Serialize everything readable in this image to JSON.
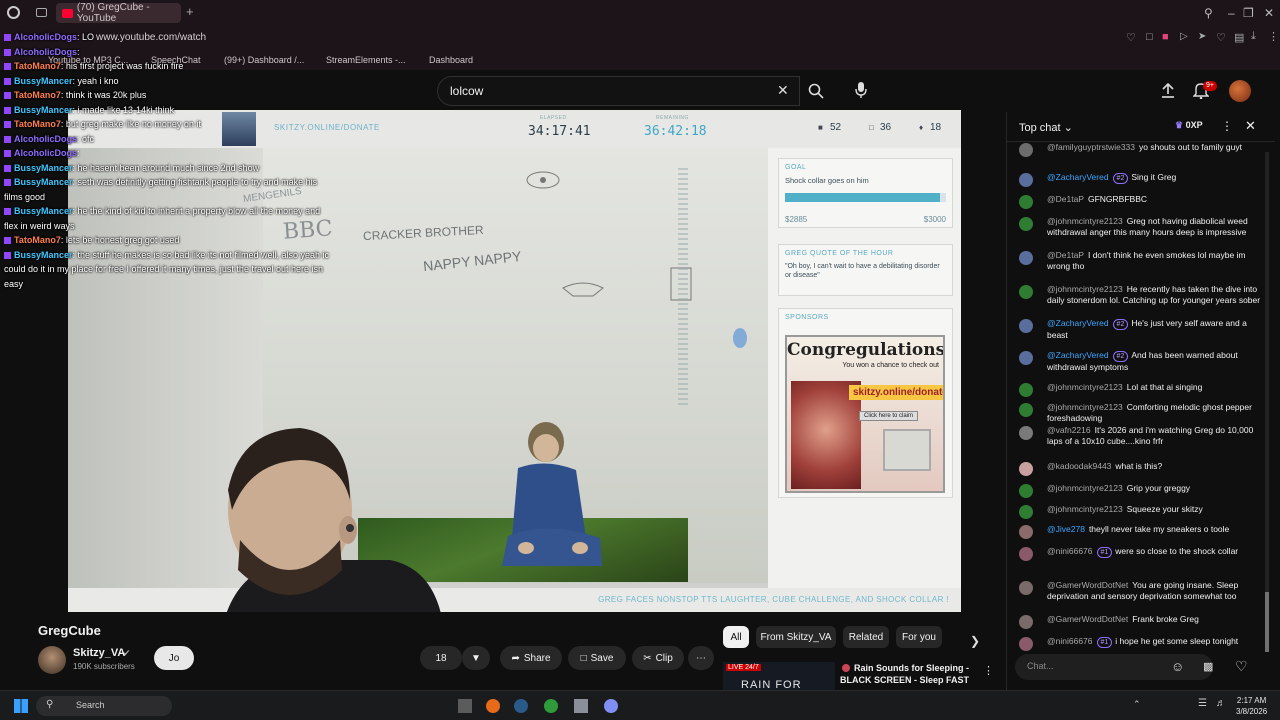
{
  "browser": {
    "tab_title": "(70) GregCube - YouTube",
    "url": "www.youtube.com/watch",
    "bookmarks": [
      "Youtube to MP3 C...",
      "SpeechChat",
      "(99+) Dashboard /...",
      "StreamElements -...",
      "Dashboard"
    ]
  },
  "youtube_header": {
    "search_value": "lolcow",
    "notification_count": "9+"
  },
  "stream_overlay": {
    "donate_url": "SKITZY.ONLINE/DONATE",
    "elapsed_label": "ELAPSED",
    "elapsed": "34:17:41",
    "remaining_label": "REMAINING",
    "remaining": "36:42:18",
    "stat1": "52",
    "stat2": "36",
    "stat3": "18",
    "goal_header": "GOAL",
    "goal_text": "Shock collar goes on him",
    "goal_current": "$2885",
    "goal_target": "$3000",
    "goal_progress": 0.96,
    "quote_header": "GREG QUOTE OF THE HOUR",
    "quote_text": "\"Oh boy, I can't wait to have a debilitating disorder or disease\"",
    "sponsors_header": "SPONSORS",
    "ad_title": "Congregulations",
    "ad_line": "You won a chance to check out",
    "ad_url": "skitzy.online/donate",
    "ad_button": "Click here to claim",
    "bottom_banner": "GREG FACES NONSTOP TTS LAUGHTER, CUBE CHALLENGE, AND SHOCK COLLAR !",
    "wall_writing": [
      "BBC",
      "CRACKER BROTHER",
      "NAPPY NAPPY",
      "MENGENILS"
    ]
  },
  "twitch_chat": [
    {
      "user": "AlcoholicDogs",
      "color": "#8e6bff",
      "text": ": LO"
    },
    {
      "user": "AlcoholicDogs",
      "color": "#8e6bff",
      "text": ":"
    },
    {
      "user": "TatoMano7",
      "color": "#ff7f50",
      "text": ": his first project was fuckin fire"
    },
    {
      "user": "BussyMancer",
      "color": "#3ec8ff",
      "text": ": yeah i kno"
    },
    {
      "user": "TatoMano7",
      "color": "#ff7f50",
      "text": ": think it was 20k plus"
    },
    {
      "user": "BussyMancer",
      "color": "#3ec8ff",
      "text": ": i made like 13-14ki think"
    },
    {
      "user": "TatoMano7",
      "color": "#ff7f50",
      "text": ": but greg make like no money on it"
    },
    {
      "user": "AlcoholicDogs",
      "color": "#8e6bff",
      "text": ": ofc"
    },
    {
      "user": "AlcoholicDogs",
      "color": "#8e6bff",
      "text": ":"
    },
    {
      "user": "BussyMancer",
      "color": "#3ec8ff",
      "text": ": he hasent been around much since 2nd show"
    },
    {
      "user": "BussyMancer",
      "color": "#3ec8ff",
      "text": ": seth was definitly getting fishtank people to try and make his"
    },
    {
      "user": "",
      "color": "#ffffff",
      "text": "films good"
    },
    {
      "user": "BussyMancer",
      "color": "#3ec8ff",
      "text": ": he the kind of kid to inherit a property blow all the money and"
    },
    {
      "user": "",
      "color": "#ffffff",
      "text": "flex in weird ways"
    },
    {
      "user": "TatoMano7",
      "color": "#ff7f50",
      "text": ": lets be honest greg got used"
    },
    {
      "user": "BussyMancer",
      "color": "#3ec8ff",
      "text": ": the stuff he makes is so bad like its not filmed well, also yeah ic"
    },
    {
      "user": "",
      "color": "#ffffff",
      "text": "could do it in my place for free I offered it many times, just the travel out here isn"
    },
    {
      "user": "",
      "color": "#ffffff",
      "text": "easy"
    }
  ],
  "below_video": {
    "channel_title": "GregCube",
    "channel_name": "Skitzy_VA",
    "subscribers": "190K subscribers",
    "join_label": "Jo",
    "like_count": "18",
    "share_label": "Share",
    "save_label": "Save",
    "clip_label": "Clip",
    "filters": [
      "All",
      "From Skitzy_VA",
      "Related",
      "For you"
    ],
    "rec_title": "Rain Sounds for Sleeping - BLACK SCREEN - Sleep FAST ...",
    "rec_badge": "LIVE 24/7",
    "rec_thumb_text": "RAIN FOR"
  },
  "live_chat": {
    "header": "Top chat",
    "xp": "0XP",
    "input_placeholder": "Chat...",
    "messages": [
      {
        "author": "@familyguyptrstwie333",
        "badge": "",
        "text": "yo shouts out to family guyt",
        "mod": false
      },
      {
        "author": "@ZacharyVered",
        "badge": "#2",
        "text": "Sing it Greg",
        "mod": true
      },
      {
        "author": "@De1taP",
        "badge": "",
        "text": "GFNGRBFBBC",
        "mod": false
      },
      {
        "author": "@johnmcintyre2123",
        "badge": "",
        "text": "Greg not having diabolical weed withdrawal anger this many hours deep is impressive",
        "mod": false
      },
      {
        "author": "@De1taP",
        "badge": "",
        "text": "I don't think he even smokes lol maybe im wrong tho",
        "mod": false
      },
      {
        "author": "@johnmcintyre2123",
        "badge": "",
        "text": "He recently has taken the dive into daily stonerdom lol. Catching up for younger years sober",
        "mod": false
      },
      {
        "author": "@ZacharyVered",
        "badge": "#2",
        "text": "He's just very self aware and a beast",
        "mod": true
      },
      {
        "author": "@ZacharyVered",
        "badge": "#2",
        "text": "And has been warned about withdrawal symptoms",
        "mod": true
      },
      {
        "author": "@johnmcintyre2123",
        "badge": "",
        "text": "Lol at that ai singing",
        "mod": false
      },
      {
        "author": "@johnmcintyre2123",
        "badge": "",
        "text": "Comforting melodic ghost pepper foreshadowing",
        "mod": false
      },
      {
        "author": "@vafn2216",
        "badge": "",
        "text": "It's 2026 and i'm watching Greg do 10,000 laps of a 10x10 cube....kino frfr",
        "mod": false
      },
      {
        "author": "@kadoodak9443",
        "badge": "",
        "text": "what is this?",
        "mod": false
      },
      {
        "author": "@johnmcintyre2123",
        "badge": "",
        "text": "Grip your greggy",
        "mod": false
      },
      {
        "author": "@johnmcintyre2123",
        "badge": "",
        "text": "Squeeze your skitzy",
        "mod": false
      },
      {
        "author": "@Jive278",
        "badge": "",
        "text": "theyll never take my sneakers o toole",
        "mod": true
      },
      {
        "author": "@nini66676",
        "badge": "#1",
        "text": "were so close to the shock collar",
        "mod": false
      },
      {
        "author": "@GamerWordDotNet",
        "badge": "",
        "text": "You are going insane. Sleep deprivation and sensory deprivation somewhat too",
        "mod": false
      },
      {
        "author": "@GamerWordDotNet",
        "badge": "",
        "text": "Frank broke Greg",
        "mod": false
      },
      {
        "author": "@nini66676",
        "badge": "#1",
        "text": "i hope he get some sleep tonight",
        "mod": false
      }
    ]
  },
  "taskbar": {
    "search_label": "Search",
    "time": "2:17 AM",
    "date": "3/8/2026"
  }
}
